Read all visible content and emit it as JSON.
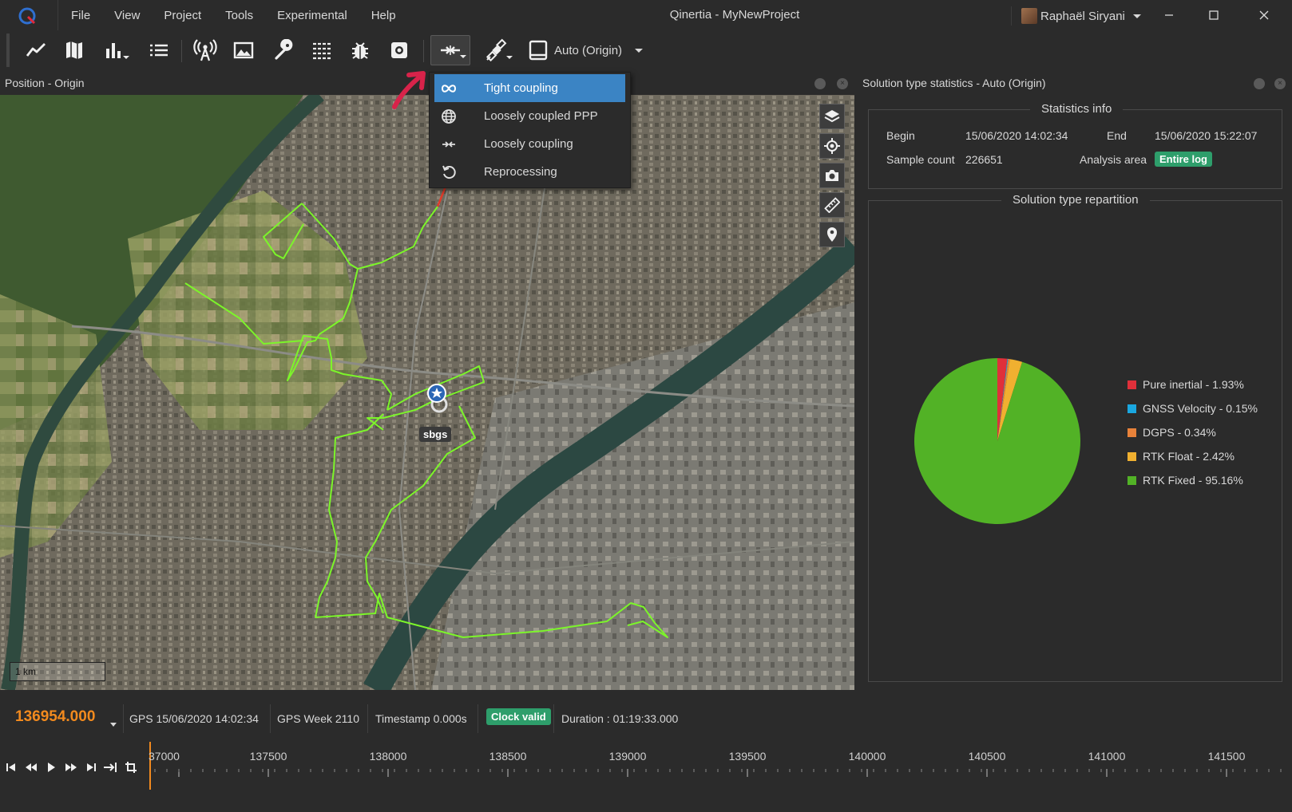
{
  "window": {
    "title": "Qinertia - MyNewProject"
  },
  "menu": {
    "items": [
      "File",
      "View",
      "Project",
      "Tools",
      "Experimental",
      "Help"
    ]
  },
  "user": {
    "name": "Raphaël Siryani"
  },
  "toolbar": {
    "auto_origin_label": "Auto (Origin)"
  },
  "left_panel": {
    "title": "Position - Origin"
  },
  "dropdown": {
    "items": [
      {
        "label": "Tight coupling",
        "icon": "infinity-icon"
      },
      {
        "label": "Loosely coupled PPP",
        "icon": "globe-icon"
      },
      {
        "label": "Loosely coupling",
        "icon": "loose-coupling-icon"
      },
      {
        "label": "Reprocessing",
        "icon": "reprocess-icon"
      }
    ]
  },
  "map": {
    "marker_label": "sbgs",
    "scale_label": "1 km"
  },
  "right_panel": {
    "title": "Solution type statistics - Auto (Origin)",
    "stats_title": "Statistics info",
    "begin_label": "Begin",
    "begin_value": "15/06/2020 14:02:34",
    "end_label": "End",
    "end_value": "15/06/2020 15:22:07",
    "sample_label": "Sample count",
    "sample_value": "226651",
    "area_label": "Analysis area",
    "area_value": "Entire log",
    "repartition_title": "Solution type repartition"
  },
  "chart_data": {
    "type": "pie",
    "title": "Solution type repartition",
    "slices": [
      {
        "name": "Pure inertial",
        "value": 1.93,
        "label": "Pure inertial - 1.93%",
        "color": "#e0303a"
      },
      {
        "name": "GNSS Velocity",
        "value": 0.15,
        "label": "GNSS Velocity - 0.15%",
        "color": "#1aa7e0"
      },
      {
        "name": "DGPS",
        "value": 0.34,
        "label": "DGPS - 0.34%",
        "color": "#e8823a"
      },
      {
        "name": "RTK Float",
        "value": 2.42,
        "label": "RTK Float - 2.42%",
        "color": "#f0b030"
      },
      {
        "name": "RTK Fixed",
        "value": 95.16,
        "label": "RTK Fixed - 95.16%",
        "color": "#52b226"
      }
    ],
    "legend_position": "right"
  },
  "status": {
    "time_value": "136954.000",
    "gps_time": "GPS 15/06/2020 14:02:34",
    "gps_week": "GPS Week 2110",
    "timestamp": "Timestamp 0.000s",
    "clock": "Clock valid",
    "duration": "Duration : 01:19:33.000"
  },
  "timeline": {
    "labels": [
      "37000",
      "137500",
      "138000",
      "138500",
      "139000",
      "139500",
      "140000",
      "140500",
      "141000",
      "141500"
    ]
  },
  "colors": {
    "accent": "#3b84c4",
    "time": "#f28a1e",
    "badge": "#2e9e6b",
    "track": "#7cf52a",
    "annotation_arrow": "#d8234a"
  }
}
